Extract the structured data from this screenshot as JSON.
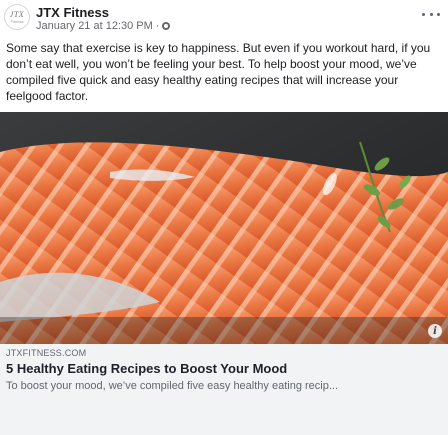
{
  "post": {
    "page_name": "JTX Fitness",
    "avatar_text": "JTX",
    "avatar_tagline": "Fitness",
    "timestamp": "January 21 at 12:30 PM",
    "meta_separator": "·",
    "privacy_icon": "globe-icon",
    "menu_icon": "more-icon",
    "text": "Some say that exercise is key to happiness. But even if you workout hard, if you don’t eat well, you won’t be feeling your best. To help boost your mood, we’ve compiled five quick and easy healthy eating recipes that will increase your feelgood factor."
  },
  "image": {
    "subject": "salmon-fillet-image",
    "info_icon": "info-icon",
    "info_label": "i"
  },
  "link_preview": {
    "domain": "JTXFITNESS.COM",
    "title": "5 Healthy Eating Recipes to Boost Your Mood",
    "description": "To boost your mood, we’ve compiled five easy healthy eating recip..."
  },
  "colors": {
    "salmon": "#e8703f",
    "salmon_light": "#f6a77e",
    "background_dark": "#2a2d30",
    "link_bg": "#f2f3f5"
  }
}
